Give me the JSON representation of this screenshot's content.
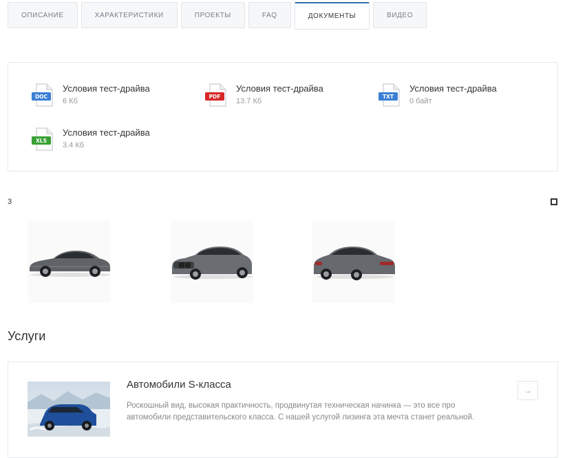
{
  "tabs": [
    {
      "label": "ОПИСАНИЕ"
    },
    {
      "label": "ХАРАКТЕРИСТИКИ"
    },
    {
      "label": "ПРОЕКТЫ"
    },
    {
      "label": "FAQ"
    },
    {
      "label": "ДОКУМЕНТЫ",
      "active": true
    },
    {
      "label": "ВИДЕО"
    }
  ],
  "documents": [
    {
      "title": "Условия тест-драйва",
      "size": "6 Кб",
      "type": "DOC",
      "icon": "doc-file-icon",
      "color": "#3a7fd5"
    },
    {
      "title": "Условия тест-драйва",
      "size": "13.7 Кб",
      "type": "PDF",
      "icon": "pdf-file-icon",
      "color": "#d62828"
    },
    {
      "title": "Условия тест-драйва",
      "size": "0 байт",
      "type": "TXT",
      "icon": "txt-file-icon",
      "color": "#3a7fd5"
    },
    {
      "title": "Условия тест-драйва",
      "size": "3.4 Кб",
      "type": "XLS",
      "icon": "xls-file-icon",
      "color": "#3aa035"
    }
  ],
  "gallery": {
    "count": "3",
    "toggle_icon": "square-icon",
    "images": [
      {
        "name": "car-side-view"
      },
      {
        "name": "car-front-view"
      },
      {
        "name": "car-rear-view"
      }
    ]
  },
  "services": {
    "title": "Услуги",
    "items": [
      {
        "name": "Автомобили S-класса",
        "description": "Роскошный вид, высокая практичность, продвинутая техническая начинка — это все про автомобили представительского класса. С нашей услугой лизинга эта мечта станет реальной.",
        "arrow": "→"
      }
    ]
  },
  "colors": {
    "accent": "#2f6fb0",
    "border": "#e6e8eb",
    "muted_text": "#999999"
  }
}
